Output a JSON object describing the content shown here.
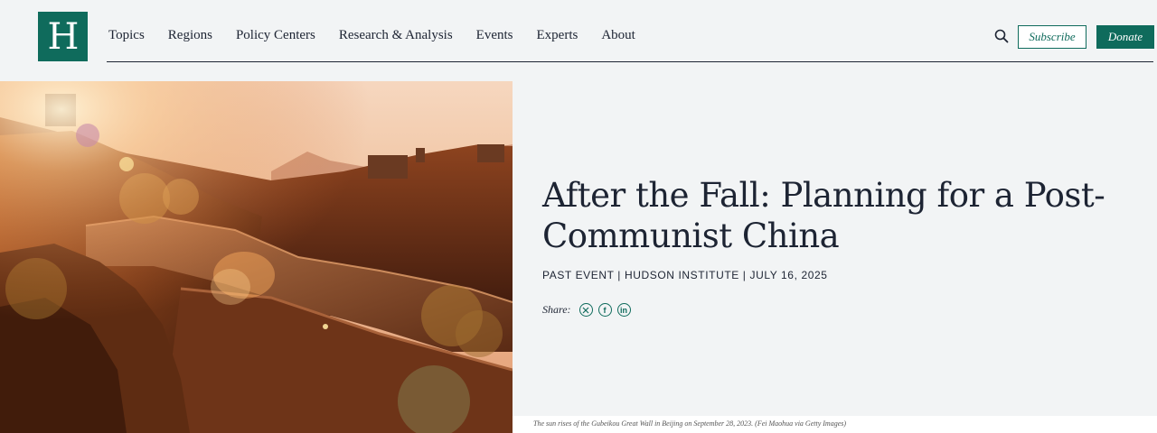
{
  "brand": {
    "logo_letter": "H",
    "accent": "#0f6b5c"
  },
  "nav": {
    "items": [
      {
        "label": "Topics",
        "name": "nav-item-topics"
      },
      {
        "label": "Regions",
        "name": "nav-item-regions"
      },
      {
        "label": "Policy Centers",
        "name": "nav-item-policy-centers"
      },
      {
        "label": "Research & Analysis",
        "name": "nav-item-research-analysis"
      },
      {
        "label": "Events",
        "name": "nav-item-events"
      },
      {
        "label": "Experts",
        "name": "nav-item-experts"
      },
      {
        "label": "About",
        "name": "nav-item-about"
      }
    ],
    "search_icon": "search-icon",
    "subscribe_label": "Subscribe",
    "donate_label": "Donate"
  },
  "hero": {
    "title": "After the Fall: Planning for a Post-Communist China",
    "meta": "PAST EVENT | HUDSON INSTITUTE | JULY 16, 2025",
    "share_label": "Share:",
    "share_icons": [
      "x-icon",
      "facebook-icon",
      "linkedin-icon"
    ],
    "caption": "The sun rises of the Gubeikou Great Wall in Beijing on September 28, 2023. (Fei Maohua via Getty Images)"
  }
}
